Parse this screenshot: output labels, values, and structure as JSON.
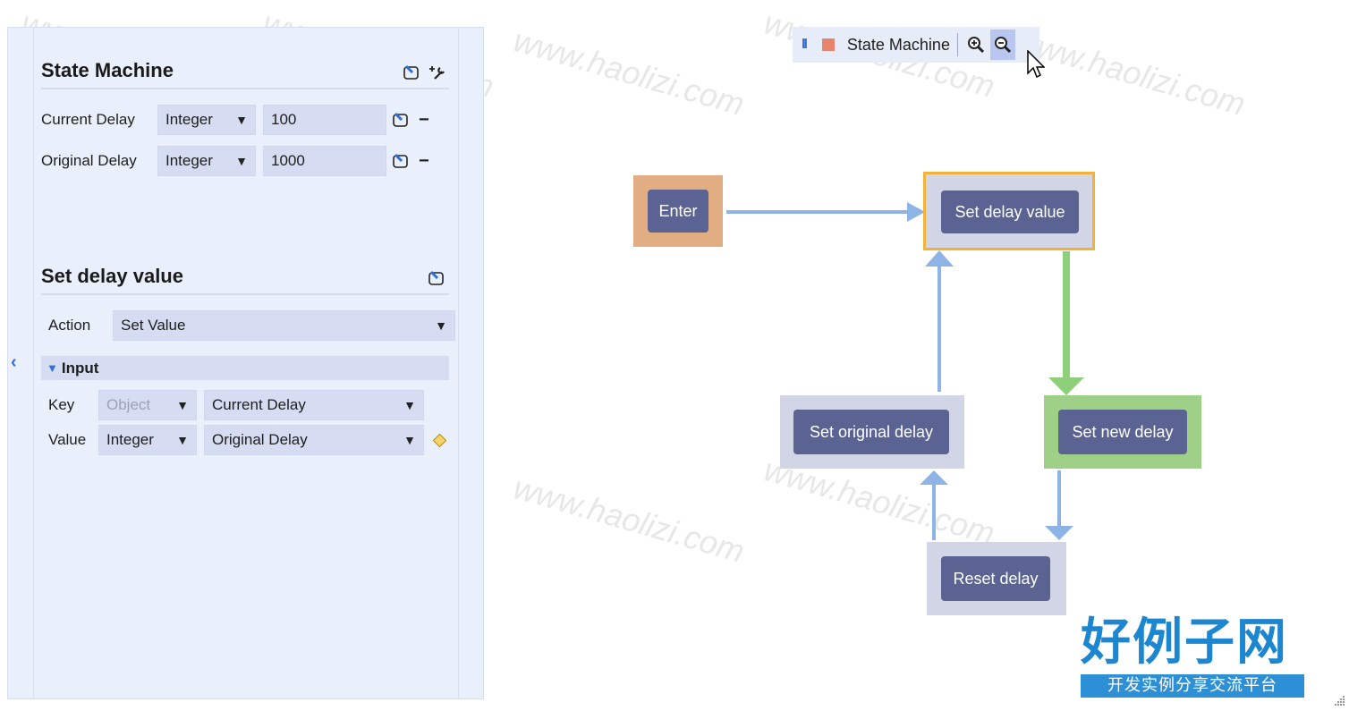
{
  "inspector": {
    "state_machine_title": "State Machine",
    "variables": [
      {
        "name": "Current Delay",
        "type": "Integer",
        "value": "100"
      },
      {
        "name": "Original Delay",
        "type": "Integer",
        "value": "1000"
      }
    ],
    "state_title": "Set delay value",
    "action_label": "Action",
    "action_value": "Set Value",
    "input_group_label": "Input",
    "key_label": "Key",
    "key_type": "Object",
    "key_value": "Current Delay",
    "value_label": "Value",
    "value_type": "Integer",
    "value_value": "Original Delay",
    "minus_glyph": "−"
  },
  "toolbar": {
    "pause_glyph": "II",
    "title": "State Machine"
  },
  "graph": {
    "nodes": {
      "enter": "Enter",
      "set_delay_value": "Set delay value",
      "set_original_delay": "Set original delay",
      "set_new_delay": "Set new delay",
      "reset_delay": "Reset delay"
    },
    "colors": {
      "enter_bg": "#e1ad82",
      "selected_border": "#f0b23a",
      "node_bg": "#d2d5e6",
      "active_bg": "#9ed088",
      "edge": "#8db4e5",
      "active_edge": "#8fcf7a",
      "button": "#5a6392"
    }
  },
  "logo": {
    "big": "好例子网",
    "small": "开发实例分享交流平台"
  },
  "watermark_text": "www.haolizi.com"
}
